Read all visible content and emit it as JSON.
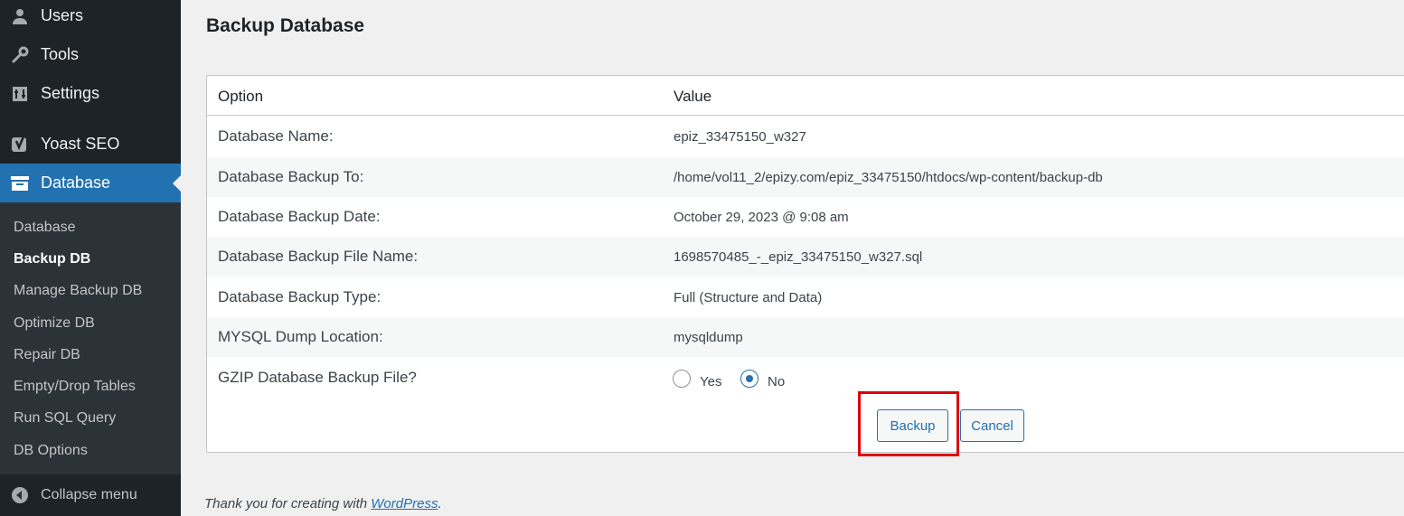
{
  "sidebar": {
    "menu": [
      {
        "label": "Users",
        "icon": "users-icon"
      },
      {
        "label": "Tools",
        "icon": "wrench-icon"
      },
      {
        "label": "Settings",
        "icon": "settings-icon"
      },
      {
        "label": "Yoast SEO",
        "icon": "yoast-icon"
      },
      {
        "label": "Database",
        "icon": "database-icon",
        "active": true
      }
    ],
    "submenu": [
      "Database",
      "Backup DB",
      "Manage Backup DB",
      "Optimize DB",
      "Repair DB",
      "Empty/Drop Tables",
      "Run SQL Query",
      "DB Options"
    ],
    "current_submenu": "Backup DB",
    "collapse_label": "Collapse menu"
  },
  "page": {
    "title": "Backup Database"
  },
  "table": {
    "headers": {
      "option": "Option",
      "value": "Value"
    },
    "rows": [
      {
        "option": "Database Name:",
        "value": "epiz_33475150_w327"
      },
      {
        "option": "Database Backup To:",
        "value": "/home/vol11_2/epizy.com/epiz_33475150/htdocs/wp-content/backup-db"
      },
      {
        "option": "Database Backup Date:",
        "value": "October 29, 2023 @ 9:08 am"
      },
      {
        "option": "Database Backup File Name:",
        "value": "1698570485_-_epiz_33475150_w327.sql"
      },
      {
        "option": "Database Backup Type:",
        "value": "Full (Structure and Data)"
      },
      {
        "option": "MYSQL Dump Location:",
        "value": "mysqldump"
      }
    ],
    "gzip": {
      "option": "GZIP Database Backup File?",
      "choices": [
        "Yes",
        "No"
      ],
      "selected": "No"
    }
  },
  "actions": {
    "backup_label": "Backup",
    "cancel_label": "Cancel"
  },
  "footer": {
    "prefix": "Thank you for creating with ",
    "link": "WordPress",
    "suffix": "."
  },
  "colors": {
    "accent": "#2271b1",
    "sidebar_bg": "#1d2327",
    "highlight": "#e0000d"
  }
}
